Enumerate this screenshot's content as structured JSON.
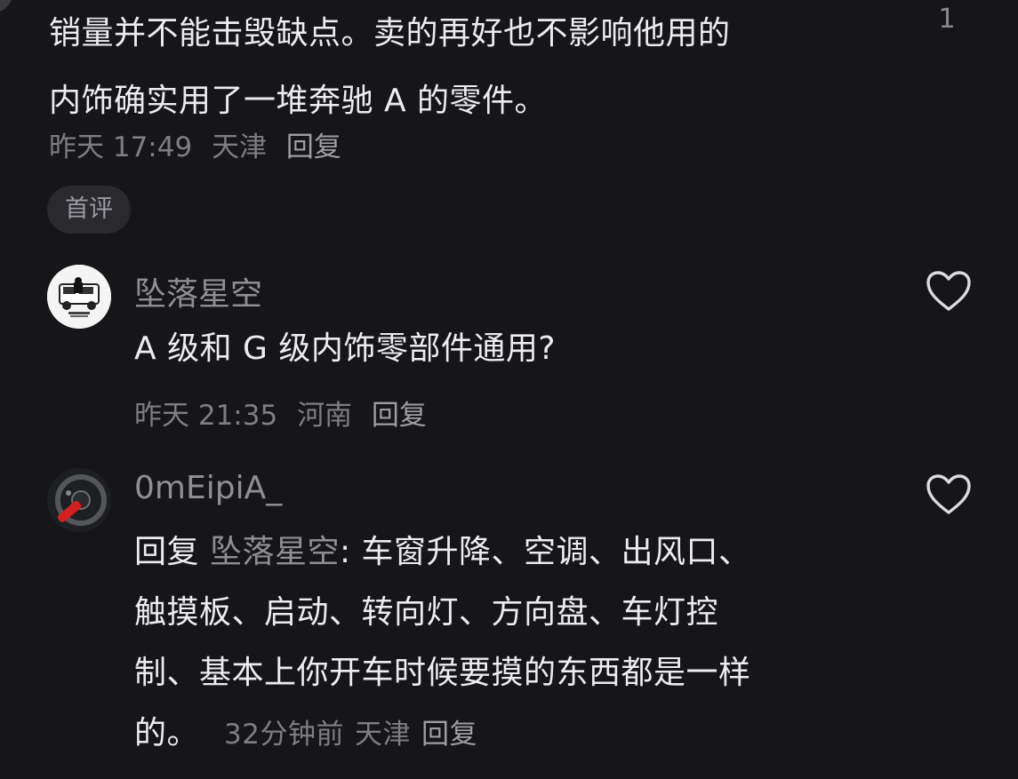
{
  "top_comment": {
    "lines": [
      "销量并不能击毁缺点。卖的再好也不影响他用的",
      "内饰确实用了一堆奔驰 A 的零件。"
    ],
    "like_count": "1",
    "time": "昨天 17:49",
    "location": "天津",
    "reply_label": "回复",
    "badge": "首评"
  },
  "replies": [
    {
      "username": "坠落星空",
      "lines": [
        "A 级和 G 级内饰零部件通用?"
      ],
      "time": "昨天 21:35",
      "location": "河南",
      "reply_label": "回复"
    },
    {
      "username": "0mEipiA_",
      "reply_prefix": "回复",
      "mention": "坠落星空",
      "first_line_rest": ": 车窗升降、空调、出风口、",
      "lines": [
        "触摸板、启动、转向灯、方向盘、车灯控",
        "制、基本上你开车时候要摸的东西都是一样",
        "的。"
      ],
      "time": "32分钟前",
      "location": "天津",
      "reply_label": "回复"
    }
  ],
  "colors": {
    "background": "#161619",
    "text_primary": "#ececee",
    "text_secondary": "#7d7d83",
    "badge_bg": "#2a2a2e"
  }
}
